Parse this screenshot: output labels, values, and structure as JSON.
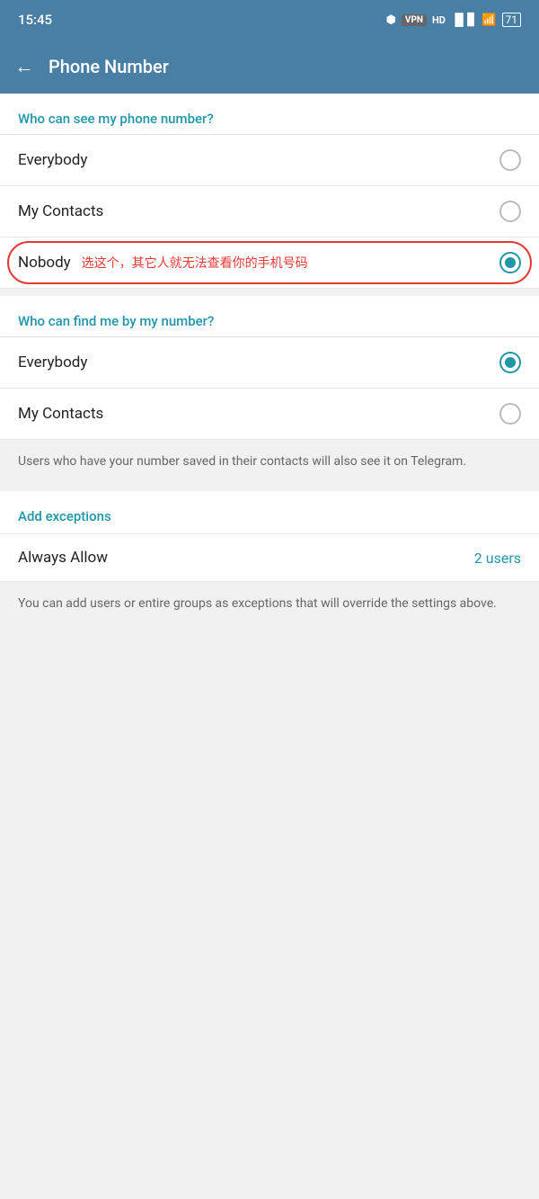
{
  "statusBar": {
    "time": "15:45",
    "icons": {
      "bluetooth": "⚡",
      "vpn": "VPN",
      "signal": "HD",
      "wifi": "WiFi",
      "battery": "71"
    }
  },
  "topBar": {
    "backLabel": "←",
    "title": "Phone Number"
  },
  "whoCanSeeSection": {
    "header": "Who can see my phone number?",
    "options": [
      {
        "label": "Everybody",
        "selected": false
      },
      {
        "label": "My Contacts",
        "selected": false
      },
      {
        "label": "Nobody",
        "selected": true,
        "annotation": "选这个，其它人就无法查看你的手机号码"
      }
    ]
  },
  "whoCanFindSection": {
    "header": "Who can find me by my number?",
    "options": [
      {
        "label": "Everybody",
        "selected": true
      },
      {
        "label": "My Contacts",
        "selected": false
      }
    ],
    "infoText": "Users who have your number saved in their contacts will also see it on Telegram."
  },
  "exceptionsSection": {
    "header": "Add exceptions",
    "alwaysAllow": {
      "label": "Always Allow",
      "count": "2 users"
    },
    "infoText": "You can add users or entire groups as exceptions that will override the settings above."
  }
}
